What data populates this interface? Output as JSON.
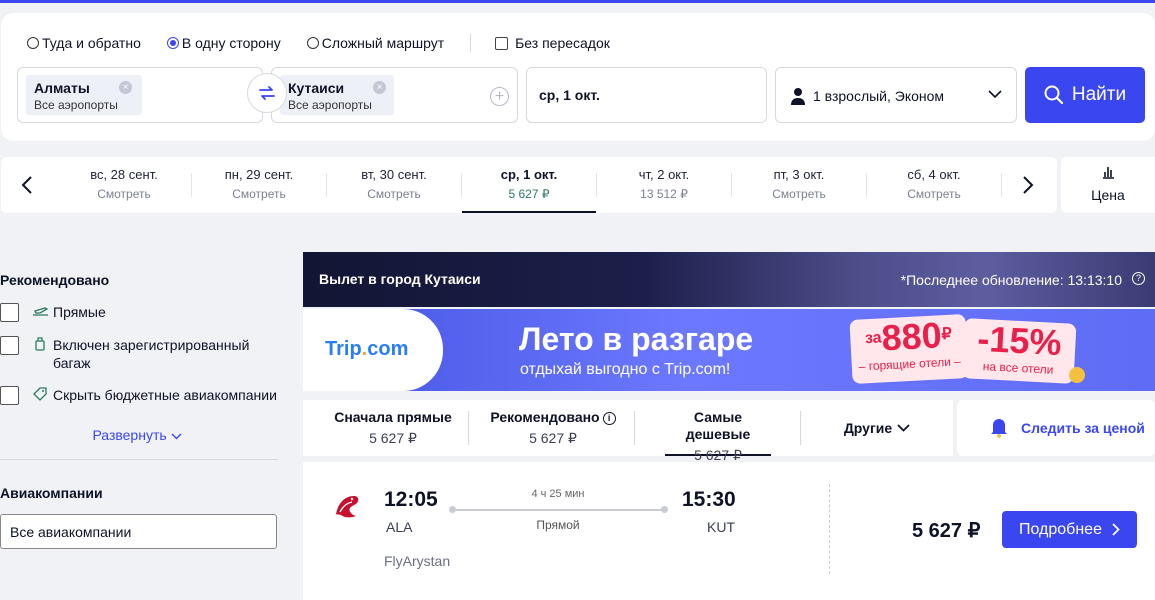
{
  "search": {
    "trip_types": [
      {
        "label": "Туда и обратно",
        "selected": false
      },
      {
        "label": "В одну сторону",
        "selected": true
      },
      {
        "label": "Сложный маршрут",
        "selected": false
      }
    ],
    "nonstop_label": "Без пересадок",
    "from": {
      "city": "Алматы",
      "sub": "Все аэропорты"
    },
    "to": {
      "city": "Кутаиси",
      "sub": "Все аэропорты"
    },
    "date": "ср, 1 окт.",
    "passengers": "1 взрослый, Эконом",
    "find_label": "Найти"
  },
  "dates": [
    {
      "date": "вс, 28 сент.",
      "sub": "Смотреть"
    },
    {
      "date": "пн, 29 сент.",
      "sub": "Смотреть"
    },
    {
      "date": "вт, 30 сент.",
      "sub": "Смотреть"
    },
    {
      "date": "ср, 1 окт.",
      "sub": "5 627 ₽",
      "selected": true
    },
    {
      "date": "чт, 2 окт.",
      "sub": "13 512 ₽"
    },
    {
      "date": "пт, 3 окт.",
      "sub": "Смотреть"
    },
    {
      "date": "сб, 4 окт.",
      "sub": "Смотреть"
    }
  ],
  "price_toggle": "Цена",
  "filters": {
    "recommended_title": "Рекомендовано",
    "items": [
      {
        "label": "Прямые",
        "icon": "plane-icon"
      },
      {
        "label": "Включен зарегистрированный багаж",
        "icon": "luggage-icon"
      },
      {
        "label": "Скрыть бюджетные авиакомпании",
        "icon": "tag-icon"
      }
    ],
    "expand_label": "Развернуть",
    "airlines_title": "Авиакомпании",
    "airlines_value": "Все авиакомпании"
  },
  "banner": {
    "title": "Вылет в город Кутаиси",
    "updated": "*Последнее обновление: 13:13:10"
  },
  "ad": {
    "logo_a": "Trip",
    "logo_dot": ".",
    "logo_b": "com",
    "headline": "Лето в разгаре",
    "subline": "отдыхай выгодно с Trip.com!",
    "price_prefix": "за",
    "price": "880",
    "currency": "₽",
    "price_note": "– горящие отели –",
    "discount": "-15%",
    "discount_note": "на все отели"
  },
  "sort": [
    {
      "label": "Сначала прямые",
      "value": "5 627 ₽"
    },
    {
      "label": "Рекомендовано",
      "value": "5 627 ₽",
      "info": true
    },
    {
      "label": "Самые дешевые",
      "value": "5 627 ₽",
      "selected": true
    }
  ],
  "sort_other": "Другие",
  "watch_label": "Следить за ценой",
  "ticket": {
    "dep_time": "12:05",
    "arr_time": "15:30",
    "dep_code": "ALA",
    "arr_code": "KUT",
    "duration": "4 ч 25 мин",
    "stops": "Прямой",
    "airline": "FlyArystan",
    "price": "5 627 ₽",
    "details_label": "Подробнее"
  },
  "colors": {
    "accent": "#3a46f0",
    "price_green": "#2c7a5e",
    "ad_red": "#e8204a"
  }
}
